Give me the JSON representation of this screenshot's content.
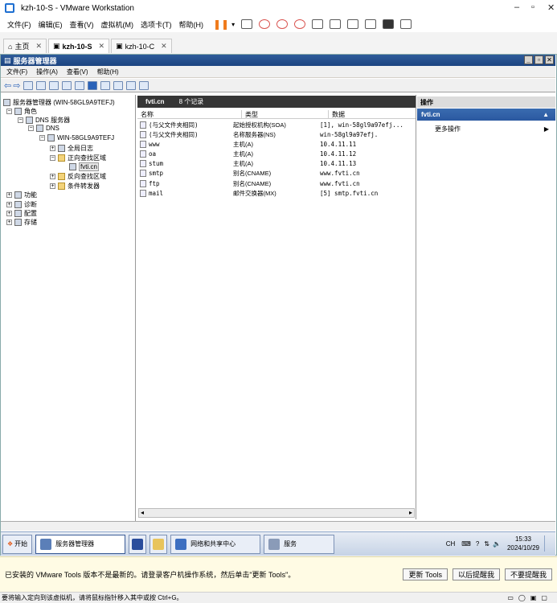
{
  "vmware": {
    "title": "kzh-10-S - VMware Workstation",
    "menu": [
      "文件(F)",
      "编辑(E)",
      "查看(V)",
      "虚拟机(M)",
      "选项卡(T)",
      "帮助(H)"
    ],
    "tabs": [
      {
        "label": "主页"
      },
      {
        "label": "kzh-10-S"
      },
      {
        "label": "kzh-10-C"
      }
    ],
    "notification": {
      "message": "已安装的 VMware Tools 版本不是最新的。请登录客户机操作系统，然后单击\"更新 Tools\"。",
      "buttons": [
        "更新 Tools",
        "以后提醒我",
        "不要提醒我"
      ]
    },
    "status_text": "要将输入定向到该虚拟机，请将鼠标指针移入其中或按 Ctrl+G。"
  },
  "mmc": {
    "title": "服务器管理器",
    "menu": [
      "文件(F)",
      "操作(A)",
      "查看(V)",
      "帮助(H)"
    ],
    "tree": {
      "root": "服务器管理器 (WIN-58GL9A9TEFJ)",
      "roles": "角色",
      "dns_server": "DNS 服务器",
      "dns": "DNS",
      "host": "WIN-58GL9A9TEFJ",
      "global_logs": "全局日志",
      "forward_zones": "正向查找区域",
      "zone": "fvti.cn",
      "reverse_zones": "反向查找区域",
      "conditional": "条件转发器",
      "features": "功能",
      "diagnostics": "诊断",
      "configuration": "配置",
      "storage": "存储"
    },
    "center": {
      "zone_name": "fvti.cn",
      "record_count": "8 个记录",
      "columns": [
        "名称",
        "类型",
        "数据"
      ],
      "records": [
        {
          "name": "(与父文件夹相同)",
          "type": "起始授权机构(SOA)",
          "data": "[1], win-58gl9a97efj..."
        },
        {
          "name": "(与父文件夹相同)",
          "type": "名称服务器(NS)",
          "data": "win-58gl9a97efj."
        },
        {
          "name": "www",
          "type": "主机(A)",
          "data": "10.4.11.11"
        },
        {
          "name": "oa",
          "type": "主机(A)",
          "data": "10.4.11.12"
        },
        {
          "name": "stum",
          "type": "主机(A)",
          "data": "10.4.11.13"
        },
        {
          "name": "smtp",
          "type": "别名(CNAME)",
          "data": "www.fvti.cn"
        },
        {
          "name": "ftp",
          "type": "别名(CNAME)",
          "data": "www.fvti.cn"
        },
        {
          "name": "mail",
          "type": "邮件交换器(MX)",
          "data": "[5]  smtp.fvti.cn"
        }
      ]
    },
    "actions": {
      "header": "操作",
      "section": "fvti.cn",
      "more": "更多操作"
    }
  },
  "taskbar": {
    "start": "开始",
    "items": [
      "服务器管理器",
      "网络和共享中心",
      "服务"
    ],
    "ime": "CH",
    "time": "15:33",
    "date": "2024/10/29"
  }
}
